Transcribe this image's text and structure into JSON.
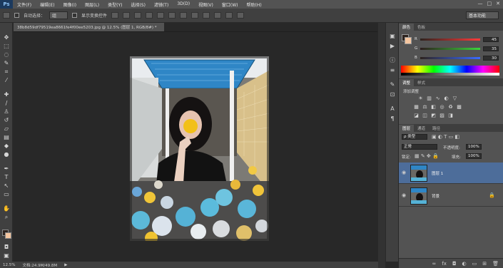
{
  "app": {
    "logo": "Ps"
  },
  "menu": [
    "文件(F)",
    "编辑(E)",
    "图像(I)",
    "图层(L)",
    "类型(Y)",
    "选择(S)",
    "滤镜(T)",
    "3D(D)",
    "视图(V)",
    "窗口(W)",
    "帮助(H)"
  ],
  "window_controls": [
    "—",
    "□",
    "✕"
  ],
  "options": {
    "auto_select_label": "自动选择：",
    "auto_select_value": "组",
    "show_transform_label": "显示变换控件",
    "workspace": "基本功能"
  },
  "document": {
    "tab_title": "38b8d59df79519ea8661fe4f00ee5203.jpg @ 12.5% (图层 1, RGB/8#) *",
    "zoom": "12.5%",
    "doc_size": "文档:24.9M/49.8M"
  },
  "color_panel": {
    "tabs": [
      "颜色",
      "色板"
    ],
    "channels": [
      {
        "label": "R",
        "value": "45",
        "color": "#ff3b3b"
      },
      {
        "label": "G",
        "value": "35",
        "color": "#3bd53b"
      },
      {
        "label": "B",
        "value": "30",
        "color": "#3b6bff"
      }
    ]
  },
  "adjust_panel": {
    "tabs": [
      "调整",
      "样式"
    ],
    "title": "添加调整"
  },
  "layers_panel": {
    "tabs": [
      "图层",
      "通道",
      "路径"
    ],
    "filter": "ρ 类型",
    "blend_mode": "正常",
    "opacity_label": "不透明度:",
    "opacity": "100%",
    "lock_label": "锁定:",
    "fill_label": "填充:",
    "fill": "100%",
    "layers": [
      {
        "name": "图层 1",
        "selected": true
      },
      {
        "name": "背景",
        "selected": false
      }
    ]
  },
  "colors": {
    "accent_selected": "#4d6d9a",
    "foreground": "#2d231e",
    "background_swatch": "#f5c6a0"
  }
}
